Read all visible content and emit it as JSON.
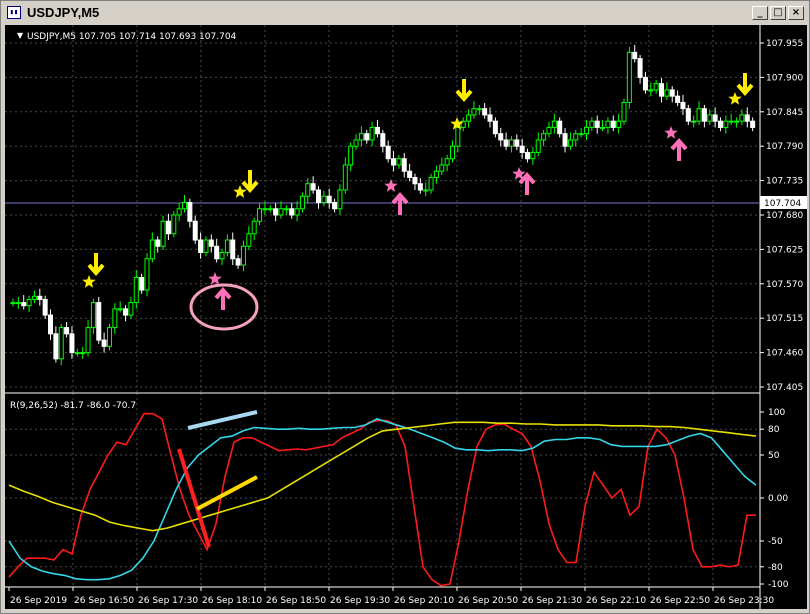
{
  "window": {
    "title": "USDJPY,M5",
    "icon": "chart-window-icon",
    "buttons": {
      "minimize": "_",
      "maximize": "□",
      "close": "×"
    }
  },
  "main_chart": {
    "header": "USDJPY,M5  107.705 107.714 107.693 107.704",
    "current_price": "107.704",
    "price_ticks": [
      "107.955",
      "107.900",
      "107.845",
      "107.790",
      "107.735",
      "107.680",
      "107.625",
      "107.570",
      "107.515",
      "107.460",
      "107.405"
    ]
  },
  "indicator": {
    "header": "R(9,26,52) -81.7 -86.0 -70.7",
    "ticks": [
      "100",
      "80",
      "50",
      "0.00",
      "-50",
      "-80",
      "-100"
    ]
  },
  "time_axis": [
    "26 Sep 2019",
    "26 Sep 16:50",
    "26 Sep 17:30",
    "26 Sep 18:10",
    "26 Sep 18:50",
    "26 Sep 19:30",
    "26 Sep 20:10",
    "26 Sep 20:50",
    "26 Sep 21:30",
    "26 Sep 22:10",
    "26 Sep 22:50",
    "26 Sep 23:30"
  ],
  "colors": {
    "bull": "#00ff00",
    "bear": "#ffffff",
    "grid": "#4a4a4a",
    "fast_line": "#ff1a1a",
    "mid_line": "#33d6e8",
    "slow_line": "#e8e000",
    "star_yellow": "#ffee00",
    "signal_pink": "#ff70b8"
  },
  "chart_data": [
    {
      "type": "candlestick",
      "title": "USDJPY,M5",
      "ylim": [
        107.405,
        107.975
      ],
      "x": [
        "26 Sep 2019",
        "26 Sep 16:50",
        "26 Sep 17:30",
        "26 Sep 18:10",
        "26 Sep 18:50",
        "26 Sep 19:30",
        "26 Sep 20:10",
        "26 Sep 20:50",
        "26 Sep 21:30",
        "26 Sep 22:10",
        "26 Sep 22:50",
        "26 Sep 23:30"
      ],
      "close": [
        107.54,
        107.54,
        107.535,
        107.545,
        107.55,
        107.545,
        107.52,
        107.49,
        107.45,
        107.5,
        107.49,
        107.46,
        107.46,
        107.46,
        107.5,
        107.54,
        107.48,
        107.47,
        107.5,
        107.53,
        107.53,
        107.52,
        107.54,
        107.58,
        107.56,
        107.61,
        107.64,
        107.63,
        107.67,
        107.65,
        107.68,
        107.69,
        107.7,
        107.67,
        107.64,
        107.62,
        107.64,
        107.63,
        107.61,
        107.62,
        107.64,
        107.61,
        107.6,
        107.63,
        107.65,
        107.67,
        107.69,
        107.69,
        107.69,
        107.68,
        107.69,
        107.69,
        107.68,
        107.69,
        107.71,
        107.73,
        107.72,
        107.7,
        107.71,
        107.7,
        107.69,
        107.72,
        107.76,
        107.79,
        107.8,
        107.81,
        107.8,
        107.82,
        107.81,
        107.79,
        107.77,
        107.76,
        107.77,
        107.75,
        107.74,
        107.73,
        107.72,
        107.72,
        107.74,
        107.75,
        107.76,
        107.77,
        107.79,
        107.82,
        107.83,
        107.84,
        107.85,
        107.85,
        107.84,
        107.83,
        107.81,
        107.8,
        107.79,
        107.8,
        107.79,
        107.78,
        107.77,
        107.78,
        107.8,
        107.81,
        107.82,
        107.83,
        107.81,
        107.79,
        107.8,
        107.81,
        107.81,
        107.82,
        107.83,
        107.82,
        107.82,
        107.83,
        107.82,
        107.83,
        107.86,
        107.94,
        107.93,
        107.9,
        107.88,
        107.88,
        107.89,
        107.87,
        107.88,
        107.87,
        107.86,
        107.85,
        107.83,
        107.83,
        107.85,
        107.83,
        107.84,
        107.83,
        107.82,
        107.83,
        107.83,
        107.83,
        107.84,
        107.83,
        107.82
      ],
      "annotations": [
        "buy-arrow",
        "sell-arrow",
        "star"
      ]
    },
    {
      "type": "line",
      "title": "R(9,26,52)",
      "ylim": [
        -110,
        110
      ],
      "series": [
        {
          "values": [
            -92,
            -80,
            -70,
            -70,
            -70,
            -72,
            -60,
            -65,
            -20,
            10,
            30,
            50,
            65,
            62,
            80,
            98,
            98,
            92,
            50,
            10,
            -20,
            -40,
            -60,
            -30,
            25,
            65,
            70,
            70,
            65,
            60,
            55,
            56,
            57,
            56,
            58,
            60,
            62,
            70,
            75,
            80,
            88,
            90,
            90,
            85,
            60,
            -10,
            -80,
            -95,
            -102,
            -100,
            -50,
            10,
            60,
            80,
            85,
            86,
            80,
            75,
            60,
            20,
            -30,
            -60,
            -75,
            -75,
            -10,
            30,
            15,
            0,
            10,
            -20,
            -10,
            60,
            80,
            70,
            50,
            0,
            -60,
            -80,
            -80,
            -78,
            -80,
            -78,
            -20,
            -20
          ]
        },
        {
          "values": [
            -50,
            -70,
            -80,
            -85,
            -88,
            -90,
            -94,
            -95,
            -95,
            -94,
            -90,
            -84,
            -70,
            -50,
            -20,
            10,
            35,
            50,
            60,
            70,
            72,
            78,
            82,
            81,
            80,
            80,
            81,
            80,
            80,
            81,
            82,
            82,
            85,
            92,
            88,
            84,
            80,
            75,
            70,
            65,
            58,
            56,
            56,
            55,
            56,
            56,
            55,
            58,
            66,
            68,
            68,
            70,
            70,
            68,
            62,
            60,
            60,
            60,
            60,
            62,
            67,
            72,
            75,
            70,
            55,
            40,
            25,
            15
          ]
        },
        {
          "values": [
            15,
            8,
            2,
            -5,
            -10,
            -15,
            -20,
            -28,
            -32,
            -35,
            -38,
            -35,
            -30,
            -25,
            -20,
            -15,
            -10,
            -5,
            0,
            10,
            20,
            30,
            40,
            50,
            60,
            70,
            78,
            80,
            82,
            84,
            86,
            88,
            88,
            88,
            87,
            87,
            86,
            86,
            85,
            85,
            85,
            85,
            84,
            84,
            84,
            83,
            83,
            82,
            80,
            78,
            76,
            74,
            72
          ]
        }
      ]
    }
  ]
}
